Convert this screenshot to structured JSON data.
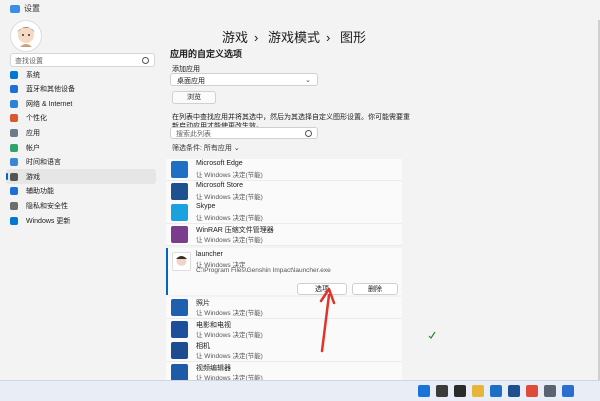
{
  "window": {
    "title": "设置"
  },
  "sidebar": {
    "search_placeholder": "查找设置",
    "items": [
      {
        "label": "系统",
        "icon": "monitor-icon",
        "color": "#0078d4"
      },
      {
        "label": "蓝牙和其他设备",
        "icon": "bluetooth-icon",
        "color": "#1b6fd6"
      },
      {
        "label": "网络 & Internet",
        "icon": "wifi-icon",
        "color": "#2b82d9"
      },
      {
        "label": "个性化",
        "icon": "brush-icon",
        "color": "#d65a2e"
      },
      {
        "label": "应用",
        "icon": "apps-icon",
        "color": "#6a7b8c"
      },
      {
        "label": "帐户",
        "icon": "account-icon",
        "color": "#2ea36a"
      },
      {
        "label": "时间和语言",
        "icon": "globe-clock-icon",
        "color": "#3b86d6"
      },
      {
        "label": "游戏",
        "icon": "gamepad-icon",
        "color": "#555555"
      },
      {
        "label": "辅助功能",
        "icon": "accessibility-icon",
        "color": "#1b6fd6"
      },
      {
        "label": "隐私和安全性",
        "icon": "shield-icon",
        "color": "#6d6d6d"
      },
      {
        "label": "Windows 更新",
        "icon": "update-icon",
        "color": "#0078d4"
      }
    ],
    "active_index": 7
  },
  "breadcrumb": {
    "items": [
      "游戏",
      "游戏模式",
      "图形"
    ],
    "separator": "›"
  },
  "main": {
    "section_title": "应用的自定义选项",
    "add_app_label": "添加应用",
    "app_type_value": "桌面应用",
    "browse_label": "浏览",
    "hint": "在列表中查找应用并将其选中，然后为其选择自定义图形设置。你可能需要重新启动应用才能使更改生效。",
    "list_search_placeholder": "搜索此列表",
    "filter_label": "筛选条件: 所有应用",
    "apps": [
      {
        "name": "Microsoft Edge",
        "sub": "让 Windows 决定(节能)",
        "icon": "edge-icon",
        "color": "#1f6fc5"
      },
      {
        "name": "Microsoft Store",
        "sub": "让 Windows 决定(节能)",
        "icon": "store-icon",
        "color": "#1d4f91"
      },
      {
        "name": "Skype",
        "sub": "让 Windows 决定(节能)",
        "icon": "skype-icon",
        "color": "#1aa1e0"
      },
      {
        "name": "WinRAR 压缩文件管理器",
        "sub": "让 Windows 决定(节能)",
        "icon": "winrar-icon",
        "color": "#7a3c8c"
      }
    ],
    "expanded": {
      "name": "launcher",
      "sub": "让 Windows 决定",
      "path": "C:\\Program Files\\Genshin Impact\\launcher.exe",
      "options_label": "选项",
      "delete_label": "删除"
    },
    "apps_after": [
      {
        "name": "照片",
        "sub": "让 Windows 决定(节能)",
        "icon": "photos-icon",
        "color": "#1f5fb0"
      },
      {
        "name": "电影和电视",
        "sub": "让 Windows 决定(节能)",
        "icon": "movies-icon",
        "color": "#1e4f9a"
      },
      {
        "name": "相机",
        "sub": "让 Windows 决定(节能)",
        "icon": "camera-icon",
        "color": "#1d4d90"
      },
      {
        "name": "视频编辑器",
        "sub": "让 Windows 决定(节能)",
        "icon": "video-editor-icon",
        "color": "#1f5aa8"
      }
    ]
  },
  "annotation": {
    "color": "#e0342b"
  },
  "taskbar": {
    "icons": [
      "start-icon",
      "search-icon",
      "task-view-icon",
      "file-explorer-icon",
      "edge-icon",
      "store-icon",
      "chrome-icon",
      "settings-icon",
      "app-icon"
    ]
  }
}
